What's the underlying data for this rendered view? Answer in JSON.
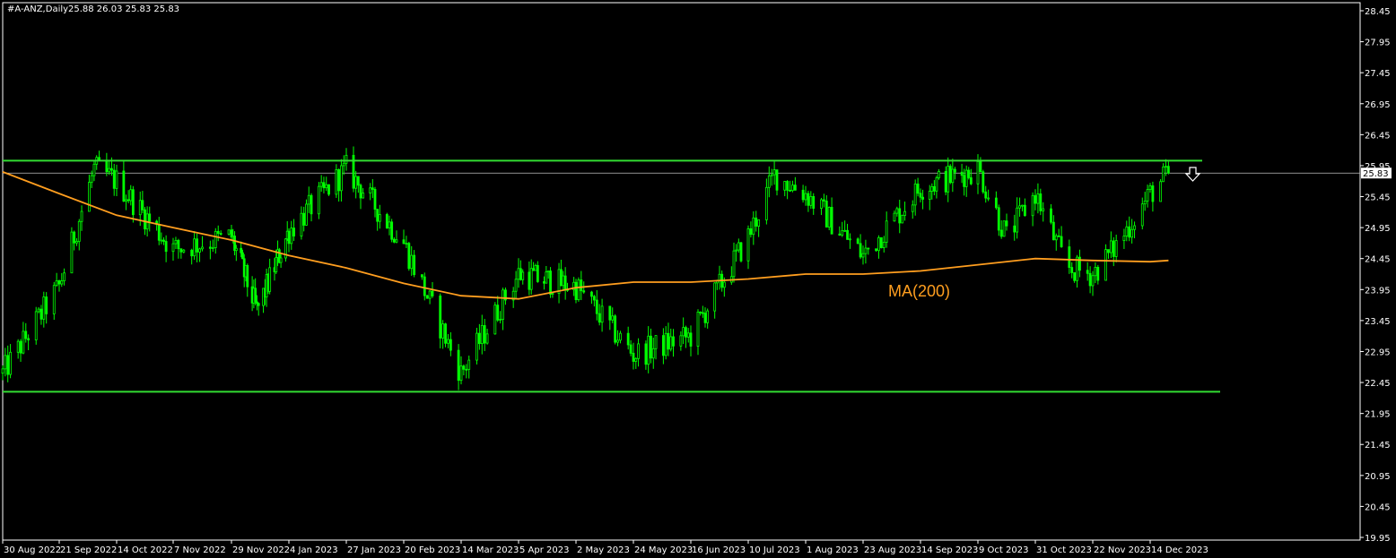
{
  "header": {
    "symbol": "#A-ANZ,Daily",
    "ohlc": "25.88 26.03 25.83 25.83"
  },
  "colors": {
    "background": "#000000",
    "frame": "#ffffff",
    "candle": "#00ff00",
    "ma": "#ff9e1f",
    "levels": "#32dc32",
    "price_line": "#c0c0c0",
    "last_price_box": "#ffffff"
  },
  "chart_data": {
    "type": "candlestick",
    "title": "#A-ANZ,Daily",
    "ylim": [
      19.95,
      28.45
    ],
    "x_tick_labels": [
      "30 Aug 2022",
      "21 Sep 2022",
      "14 Oct 2022",
      "7 Nov 2022",
      "29 Nov 2022",
      "4 Jan 2023",
      "27 Jan 2023",
      "20 Feb 2023",
      "14 Mar 2023",
      "5 Apr 2023",
      "2 May 2023",
      "24 May 2023",
      "16 Jun 2023",
      "10 Jul 2023",
      "1 Aug 2023",
      "23 Aug 2023",
      "14 Sep 2023",
      "9 Oct 2023",
      "31 Oct 2023",
      "22 Nov 2023",
      "14 Dec 2023"
    ],
    "y_tick_labels": [
      "28.45",
      "27.95",
      "27.45",
      "26.95",
      "26.45",
      "25.95",
      "25.45",
      "24.95",
      "24.45",
      "23.95",
      "23.45",
      "22.95",
      "22.45",
      "21.95",
      "21.45",
      "20.95",
      "20.45",
      "19.95"
    ],
    "last_price": "25.83",
    "indicator": {
      "name": "MA(200)",
      "label": "MA(200)"
    },
    "price_path": [
      [
        "30 Aug 2022",
        22.6
      ],
      [
        "21 Sep 2022",
        24.0
      ],
      [
        "5 Oct 2022",
        25.9
      ],
      [
        "14 Oct 2022",
        25.7
      ],
      [
        "7 Nov 2022",
        24.6
      ],
      [
        "29 Nov 2022",
        24.8
      ],
      [
        "15 Dec 2022",
        23.6
      ],
      [
        "4 Jan 2023",
        24.9
      ],
      [
        "27 Jan 2023",
        25.9
      ],
      [
        "20 Feb 2023",
        24.7
      ],
      [
        "14 Mar 2023",
        22.6
      ],
      [
        "5 Apr 2023",
        24.2
      ],
      [
        "2 May 2023",
        24.0
      ],
      [
        "24 May 2023",
        22.9
      ],
      [
        "16 Jun 2023",
        23.2
      ],
      [
        "10 Jul 2023",
        24.8
      ],
      [
        "20 Jul 2023",
        25.8
      ],
      [
        "1 Aug 2023",
        25.5
      ],
      [
        "23 Aug 2023",
        24.5
      ],
      [
        "14 Sep 2023",
        25.6
      ],
      [
        "9 Oct 2023",
        25.9
      ],
      [
        "20 Oct 2023",
        24.8
      ],
      [
        "31 Oct 2023",
        25.5
      ],
      [
        "12 Nov 2023",
        24.3
      ],
      [
        "22 Nov 2023",
        24.2
      ],
      [
        "30 Nov 2023",
        24.6
      ],
      [
        "14 Dec 2023",
        25.5
      ],
      [
        "21 Dec 2023",
        25.83
      ]
    ],
    "ma_path": [
      [
        "30 Aug 2022",
        25.85
      ],
      [
        "21 Sep 2022",
        25.5
      ],
      [
        "14 Oct 2022",
        25.15
      ],
      [
        "7 Nov 2022",
        24.95
      ],
      [
        "29 Nov 2022",
        24.75
      ],
      [
        "4 Jan 2023",
        24.5
      ],
      [
        "27 Jan 2023",
        24.3
      ],
      [
        "20 Feb 2023",
        24.05
      ],
      [
        "14 Mar 2023",
        23.85
      ],
      [
        "5 Apr 2023",
        23.8
      ],
      [
        "2 May 2023",
        23.98
      ],
      [
        "24 May 2023",
        24.07
      ],
      [
        "16 Jun 2023",
        24.07
      ],
      [
        "10 Jul 2023",
        24.12
      ],
      [
        "1 Aug 2023",
        24.2
      ],
      [
        "23 Aug 2023",
        24.2
      ],
      [
        "14 Sep 2023",
        24.25
      ],
      [
        "9 Oct 2023",
        24.35
      ],
      [
        "31 Oct 2023",
        24.45
      ],
      [
        "22 Nov 2023",
        24.42
      ],
      [
        "14 Dec 2023",
        24.4
      ],
      [
        "21 Dec 2023",
        24.42
      ]
    ],
    "horizontal_levels": [
      26.03,
      22.3
    ]
  }
}
